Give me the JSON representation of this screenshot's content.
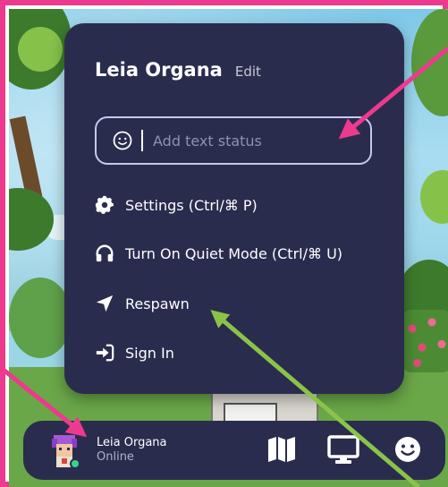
{
  "menu": {
    "user_name": "Leia Organa",
    "edit_label": "Edit",
    "status_placeholder": "Add text status",
    "items": [
      {
        "icon": "gear-icon",
        "label": "Settings (Ctrl/⌘ P)"
      },
      {
        "icon": "headphones-icon",
        "label": "Turn On Quiet Mode (Ctrl/⌘ U)"
      },
      {
        "icon": "location-arrow-icon",
        "label": "Respawn"
      },
      {
        "icon": "sign-in-icon",
        "label": "Sign In"
      }
    ]
  },
  "bottom_bar": {
    "name": "Leia Organa",
    "status": "Online",
    "icons": [
      "map-icon",
      "monitor-icon",
      "smiley-icon"
    ]
  },
  "colors": {
    "panel": "#2a2c4e",
    "highlight_frame": "#ec3a8e",
    "arrow_pink": "#ec3a8e",
    "arrow_green": "#8bc34a",
    "online": "#3ad38a"
  }
}
